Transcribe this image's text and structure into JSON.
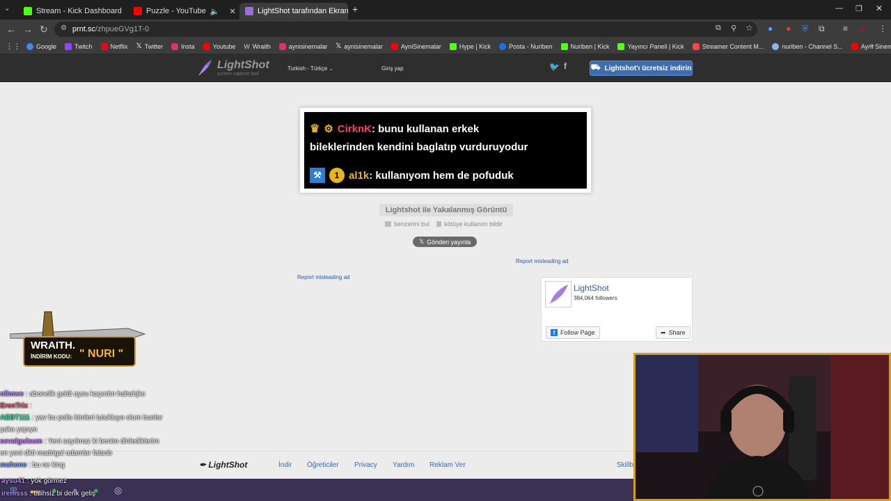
{
  "browser": {
    "tabs": [
      {
        "title": "Stream - Kick Dashboard",
        "favicon_color": "#53fc18",
        "active": false
      },
      {
        "title": "Puzzle - YouTube",
        "favicon_color": "#ff0000",
        "active": false
      },
      {
        "title": "LightShot tarafından Ekran Gör",
        "favicon_color": "#9b6fd6",
        "active": true
      }
    ],
    "new_tab": "+",
    "url_domain": "prnt.sc",
    "url_path": "/zhpueGVg1T-0",
    "bookmarks": [
      {
        "label": "Google",
        "color": "#4285f4"
      },
      {
        "label": "Twitch",
        "color": "#9146ff"
      },
      {
        "label": "Netflix",
        "color": "#e50914"
      },
      {
        "label": "Twitter",
        "color": "#ffffff"
      },
      {
        "label": "Insta",
        "color": "#e1306c"
      },
      {
        "label": "Youtube",
        "color": "#ff0000"
      },
      {
        "label": "Wraith",
        "color": "#cccccc"
      },
      {
        "label": "aynisinemalar",
        "color": "#e1306c"
      },
      {
        "label": "aynisinemalar",
        "color": "#ffffff"
      },
      {
        "label": "AyniSinemalar",
        "color": "#ff0000"
      },
      {
        "label": "Hype | Kick",
        "color": "#53fc18"
      },
      {
        "label": "Posta - Nuriben",
        "color": "#1a73e8"
      },
      {
        "label": "Nuriben | Kick",
        "color": "#53fc18"
      },
      {
        "label": "Yayıncı Paneli | Kick",
        "color": "#53fc18"
      },
      {
        "label": "Streamer Content M...",
        "color": "#ff4444"
      },
      {
        "label": "nuriben - Channel S...",
        "color": "#8ab4f8"
      },
      {
        "label": "Aynı Sinemalar - Ça...",
        "color": "#ff0000"
      }
    ]
  },
  "site": {
    "logo_name": "LightShot",
    "logo_tagline": "screen capture tool",
    "language": "Turkish - Türkçe",
    "login": "Giriş yap",
    "download_button": "Lightshot'ı ücretsiz indirin",
    "screenshot": {
      "line1_user": "CirknK",
      "line1_text": ": bunu kullanan erkek",
      "line2_text": "bileklerinden kendini baglatıp vurduruyodur",
      "line3_user": "al1k",
      "line3_text": ": kullanıyom hem de pofuduk"
    },
    "caption": "Lightshot ile Yakalanmış Görüntü",
    "similar": "benzerini bul",
    "report_abuse": "kötüye kullanım bildir",
    "post_button": "Gönderi yayınla",
    "report_ad": "Report misleading ad",
    "fb": {
      "name": "LightShot",
      "followers": "384,064 followers",
      "follow": "Follow Page",
      "share": "Share"
    },
    "footer": {
      "logo": "LightShot",
      "links": [
        "İndir",
        "Öğreticiler",
        "Privacy",
        "Yardım",
        "Reklam Ver"
      ],
      "extra": "Skillb"
    }
  },
  "overlay": {
    "promo_brand": "WRAITH.",
    "promo_label": "İNDİRİM KODU:",
    "promo_code": "\" NURI \"",
    "chat": [
      {
        "user": "nllmwe",
        "color": "#b88cff",
        "text": ": abonelik geldi aysu kaçırdın hahahjks"
      },
      {
        "user": "ErenTrix",
        "color": "#ff4d6d",
        "text": ":"
      },
      {
        "user": "AEBT111",
        "color": "#45e0a0",
        "text": ": yav bu polis kimleri tutukluyo olum bunlar"
      },
      {
        "user": "",
        "color": "#ffffff",
        "text": "şaka yapıyo"
      },
      {
        "user": "sevalgulsum",
        "color": "#c77dff",
        "text": ": Yeni sayılmaz ki benim dinlediklerim"
      },
      {
        "user": "",
        "color": "#ffffff",
        "text": "en yeni dkti madrigal adamlar falanb"
      },
      {
        "user": "mahone",
        "color": "#7aa7ff",
        "text": ": bu ne king"
      },
      {
        "user": "aysu41",
        "color": "#b88cff",
        "text": ": yok görmez"
      },
      {
        "user": "iremsss",
        "color": "#b88cff",
        "text": ": talihsiz bi denk geliş"
      }
    ]
  }
}
